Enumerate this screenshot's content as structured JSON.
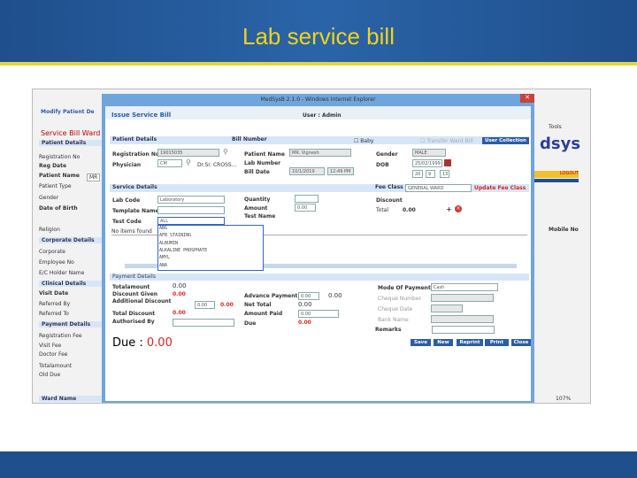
{
  "slide": {
    "title": "Lab service bill"
  },
  "window": {
    "title": "MedSysB 2.1.0 - Windows Internet Explorer"
  },
  "form": {
    "heading": "Issue Service Bill",
    "user": "User : Admin",
    "patient_details": "Patient Details",
    "bill_number": "Bill Number",
    "baby": "Baby",
    "transfer": "Transfer Ward Bill",
    "user_collection": "User Collection",
    "reg_no_label": "Registration No",
    "reg_no": "19015035",
    "physician_label": "Physician",
    "physician": "CM",
    "physician_name": "Dr.Sr. CROSS...",
    "patient_name_label": "Patient Name",
    "patient_name": "MR. Vignesh",
    "lab_number_label": "Lab Number",
    "bill_date_label": "Bill Date",
    "bill_date": "10/1/2019",
    "bill_time": "12:49 PM",
    "gender_label": "Gender",
    "gender": "MALE",
    "dob_label": "DOB",
    "dob": "25/02/1999",
    "age_y": "20",
    "age_m": "9",
    "age_d": "13",
    "service_details": "Service Details",
    "fee_class_label": "Fee Class",
    "fee_class": "GENERAL WARD",
    "update_fee": "Update Fee Class",
    "lab_code_label": "Lab Code",
    "lab_code": "Laboratory",
    "template_label": "Template Name",
    "test_code_label": "Test Code",
    "test_code": "ALL",
    "quantity_label": "Quantity",
    "amount_label": "Amount",
    "amount": "0.00",
    "test_name_label": "Test Name",
    "discount_label": "Discount",
    "total_label": "Total",
    "total": "0.00",
    "no_items": "No items found",
    "dropdown": [
      "ABG",
      "AFB STAINING",
      "ALBUMIN",
      "ALKALINE PHOSPHATE",
      "AMYL",
      "ANA"
    ],
    "payment_details": "Payment Details",
    "totalamount_label": "Totalamount",
    "totalamount": "0.00",
    "discount_given_label": "Discount Given",
    "discount_given": "0.00",
    "additional_discount_label": "Additional Discount",
    "additional_discount": "0.00",
    "additional_discount_val": "0.00",
    "total_discount_label": "Total Discount",
    "total_discount": "0.00",
    "authorised_label": "Authorised By",
    "advance_label": "Advance Payment",
    "advance": "0.00",
    "advance_val": "0.00",
    "net_total_label": "Net Total",
    "net_total": "0.00",
    "amount_paid_label": "Amount Paid",
    "amount_paid": "0.00",
    "due_label": "Due",
    "due": "0.00",
    "mode_label": "Mode Of Payment",
    "mode": "Cash",
    "cheque_no_label": "Cheque Number",
    "cheque_date_label": "Cheque Date",
    "bank_label": "Bank Name",
    "remarks_label": "Remarks",
    "due_big_label": "Due : ",
    "due_big": "0.00",
    "buttons": [
      "Save",
      "New",
      "Reprint",
      "Print",
      "Close"
    ]
  },
  "background_page": {
    "modify": "Modify Patient De",
    "service_bill": "Service Bill  Ward",
    "items": [
      "Patient Details",
      "Registration No",
      "Reg Date",
      "Patient Name",
      "Patient Type",
      "Gender",
      "Date of Birth",
      "Religion",
      "Corporate Details",
      "Corporate",
      "Employee No",
      "E/C Holder Name",
      "Clinical Details",
      "Visit Date",
      "Referred By",
      "Referred To",
      "Payment Details",
      "Registration Fee",
      "Visit Fee",
      "Doctor Fee",
      "Totalamount",
      "Old Due",
      "Ward Name"
    ],
    "salutation": "MR",
    "tools": "Tools",
    "brand": "dsys",
    "logout": "LOGOUT",
    "mobile": "Mobile No",
    "zoom": "107%"
  }
}
